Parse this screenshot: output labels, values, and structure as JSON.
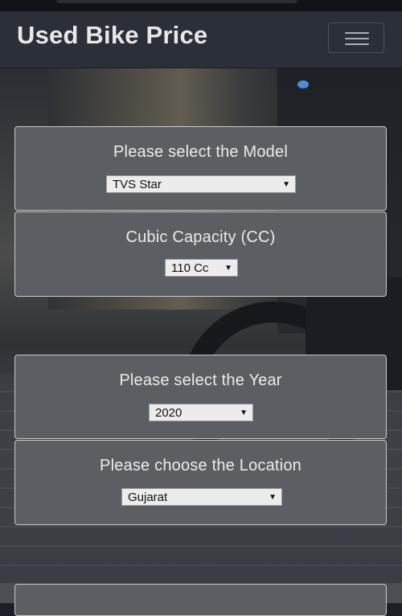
{
  "header": {
    "brand": "Used Bike Price",
    "menu_icon": "hamburger-menu-icon"
  },
  "form": {
    "model": {
      "label": "Please select the Model",
      "selected": "TVS Star"
    },
    "cc": {
      "label": "Cubic Capacity (CC)",
      "selected": "110 Cc"
    },
    "year": {
      "label": "Please select the Year",
      "selected": "2020"
    },
    "location": {
      "label": "Please choose the Location",
      "selected": "Gujarat"
    },
    "dropdown_icon": "dropdown-arrow-icon"
  },
  "colors": {
    "navbar": "#2b3038",
    "card": "#5b5e63",
    "card_border": "#c8cacc",
    "text": "#ececec"
  }
}
